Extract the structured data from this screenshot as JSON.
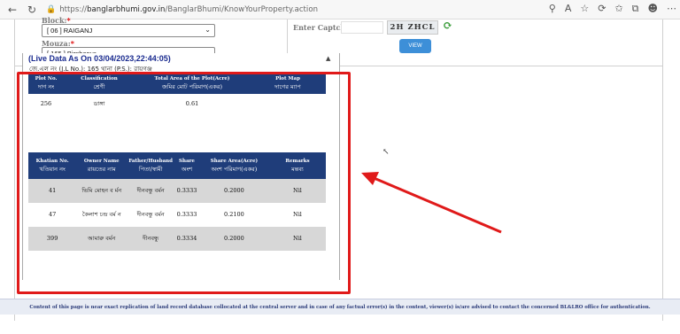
{
  "browser": {
    "url_prefix": "https://",
    "url_host": "banglarbhumi.gov.in",
    "url_path": "/BanglarBhumi/KnowYourProperty.action"
  },
  "form": {
    "block_label": "Block:",
    "block_value": "[ 06 ] RAIGANJ",
    "mouza_label": "Mouza:",
    "mouza_value": "[ 165 ] Birnhapur",
    "captcha_label": "Enter Captcha",
    "captcha_text": "2H ZHCL",
    "view_button": "VIEW"
  },
  "result": {
    "live_data": "(Live Data As On 03/04/2023,22:44:05)",
    "jl_line": "জে.এল নং (J.L No.): 165 থানা (P.S.): রায়গঞ্জ",
    "plot_table": {
      "headers": [
        {
          "en": "Plot No.",
          "bn": "দাগ নং"
        },
        {
          "en": "Classification",
          "bn": "শ্রেণী"
        },
        {
          "en": "Total Area of the Plot(Acre)",
          "bn": "জমির মোট পরিমাণ(একর)"
        },
        {
          "en": "Plot Map",
          "bn": "দাগের ম্যাপ"
        }
      ],
      "row": {
        "plot_no": "256",
        "classification": "ডাঙ্গা",
        "total_area": "0.61",
        "plot_map": ""
      }
    },
    "owner_table": {
      "headers": [
        {
          "en": "Khatian No.",
          "bn": "খতিয়ান নং"
        },
        {
          "en": "Owner Name",
          "bn": "রায়তের নাম"
        },
        {
          "en": "Father/Husband",
          "bn": "পিতা/স্বামী"
        },
        {
          "en": "Share",
          "bn": "অংশ"
        },
        {
          "en": "Share Area(Acre)",
          "bn": "অংশ পরিমাণ(একর)"
        },
        {
          "en": "Remarks",
          "bn": "মন্তব্য"
        }
      ],
      "rows": [
        {
          "khatian": "41",
          "owner": "ভিমি মোহন ব র্মন",
          "father": "দীনবন্ধু বর্মন",
          "share": "0.3333",
          "share_area": "0.2000",
          "remarks": "Nil"
        },
        {
          "khatian": "47",
          "owner": "কৈলাশ চন্দ্র বর্ম ন",
          "father": "দীনবন্ধু বর্মন",
          "share": "0.3333",
          "share_area": "0.2100",
          "remarks": "Nil"
        },
        {
          "khatian": "399",
          "owner": "আমারু বর্মন",
          "father": "দীনবন্ধু",
          "share": "0.3334",
          "share_area": "0.2000",
          "remarks": "Nil"
        }
      ]
    }
  },
  "footer": "Content of this page is near exact replication of land record database collocated at the central server and in case of any factual error(s) in the content, viewer(s) is/are advised to contact the concerned BL&LRO office for authentication.",
  "colors": {
    "header_bg": "#1f3d7a",
    "highlight": "#e01a1a",
    "live_text": "#1a2b8f"
  }
}
